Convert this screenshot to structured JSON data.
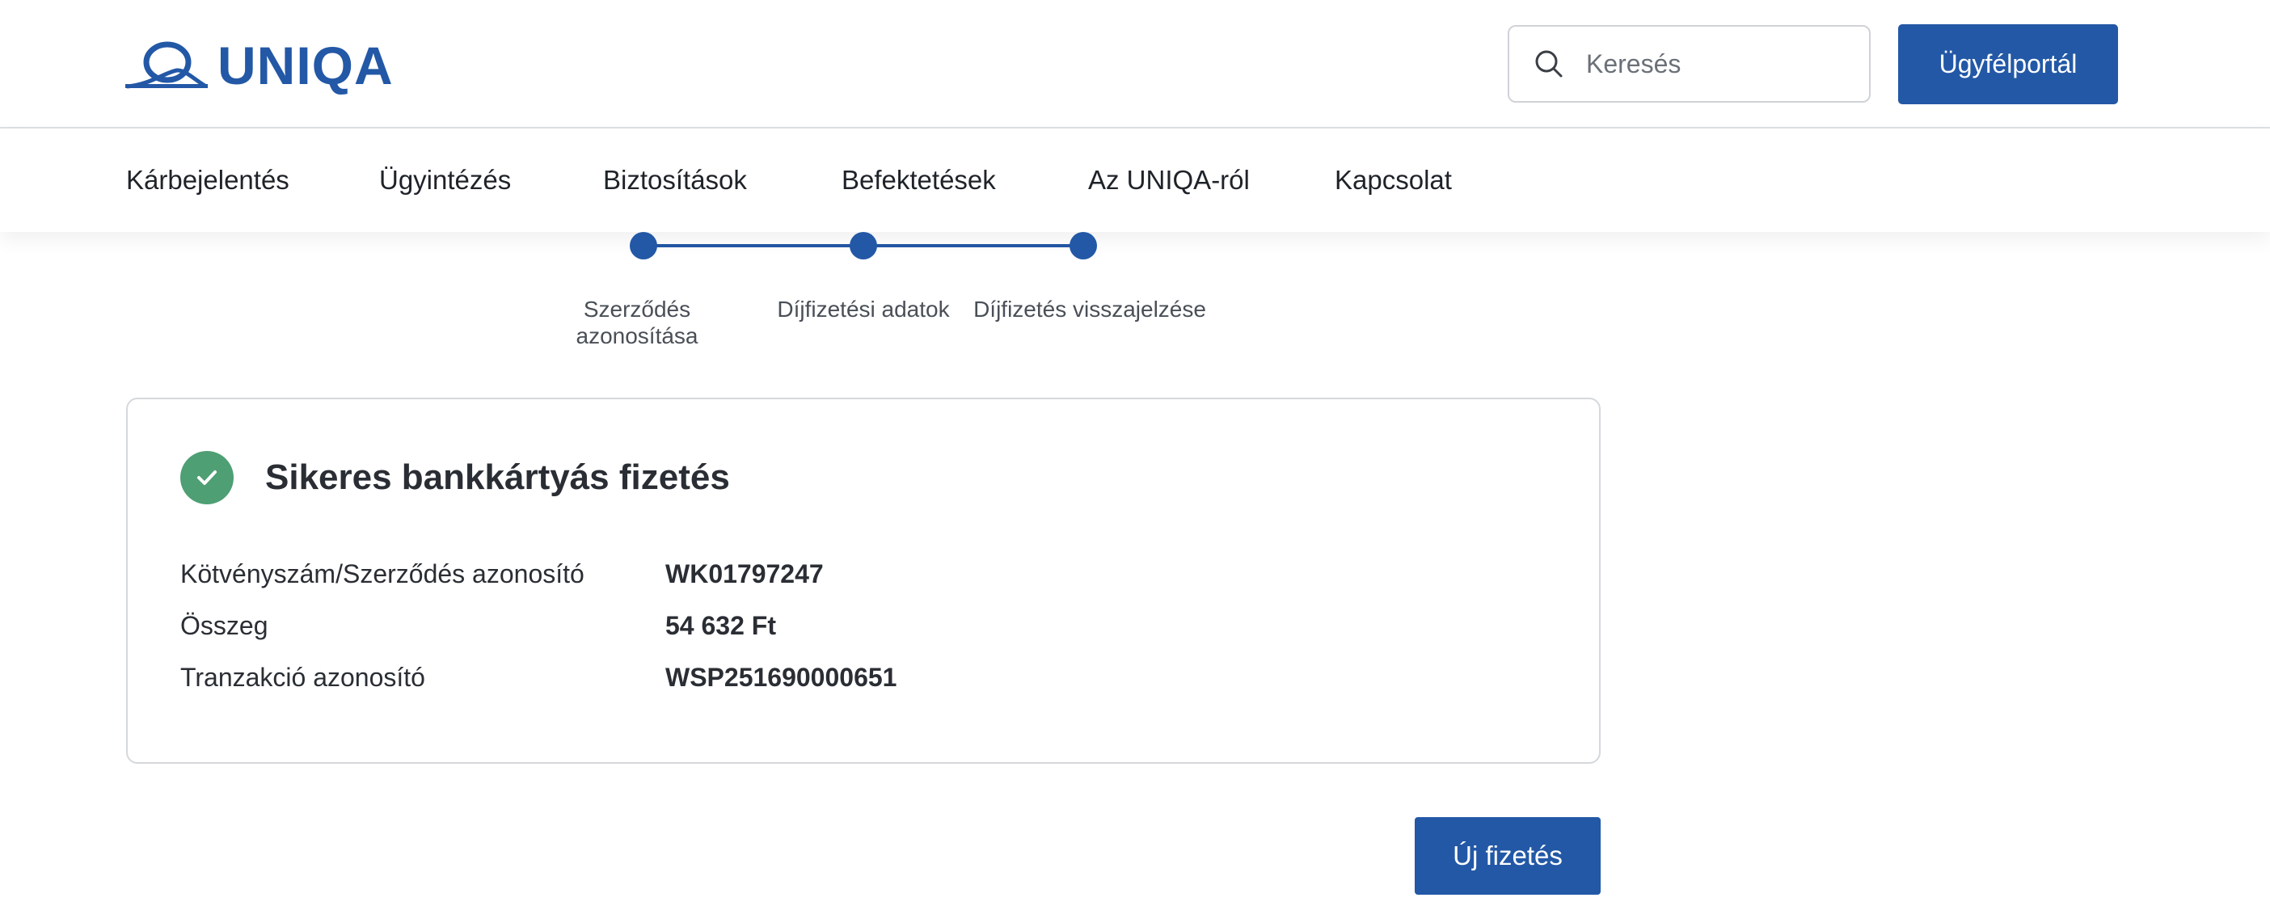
{
  "brand": {
    "logo_text": "UNIQA",
    "color": "#2358a6"
  },
  "header": {
    "search": {
      "placeholder": "Keresés",
      "value": "",
      "icon": "search-icon"
    },
    "portal_button_label": "Ügyfélportál"
  },
  "nav": {
    "items": [
      {
        "label": "Kárbejelentés"
      },
      {
        "label": "Ügyintézés"
      },
      {
        "label": "Biztosítások"
      },
      {
        "label": "Befektetések"
      },
      {
        "label": "Az UNIQA-ról"
      },
      {
        "label": "Kapcsolat"
      }
    ]
  },
  "stepper": {
    "steps": [
      {
        "label_line1": "Szerződés",
        "label_line2": "azonosítása",
        "status": "completed"
      },
      {
        "label_line1": "Díjfizetési adatok",
        "label_line2": "",
        "status": "completed"
      },
      {
        "label_line1": "Díjfizetés visszajelzése",
        "label_line2": "",
        "status": "completed"
      }
    ],
    "active_color": "#2358a6"
  },
  "result": {
    "status_icon": "check-circle-icon",
    "status_color": "#4e9f73",
    "title": "Sikeres bankkártyás fizetés",
    "rows": [
      {
        "label": "Kötvényszám/Szerződés azonosító",
        "value": "WK01797247"
      },
      {
        "label": "Összeg",
        "value": "54 632 Ft"
      },
      {
        "label": "Tranzakció azonosító",
        "value": "WSP251690000651"
      }
    ]
  },
  "actions": {
    "new_payment_label": "Új fizetés"
  }
}
